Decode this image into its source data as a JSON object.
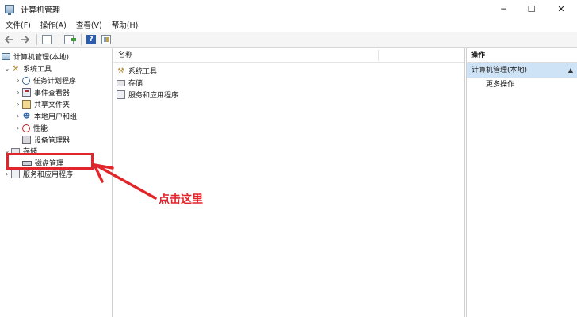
{
  "window": {
    "title": "计算机管理",
    "controls": {
      "minimize": "─",
      "maximize": "☐",
      "close": "✕"
    }
  },
  "menu": {
    "items": [
      "文件(F)",
      "操作(A)",
      "查看(V)",
      "帮助(H)"
    ]
  },
  "toolbar": {
    "back": "back-arrow-icon",
    "forward": "forward-arrow-icon",
    "help_label": "?"
  },
  "tree": {
    "root": "计算机管理(本地)",
    "system_tools": "系统工具",
    "task_scheduler": "任务计划程序",
    "event_viewer": "事件查看器",
    "shared_folders": "共享文件夹",
    "local_users": "本地用户和组",
    "performance": "性能",
    "device_manager": "设备管理器",
    "storage": "存储",
    "disk_management": "磁盘管理",
    "services_apps": "服务和应用程序"
  },
  "center": {
    "column_name": "名称",
    "rows": [
      "系统工具",
      "存储",
      "服务和应用程序"
    ]
  },
  "actions": {
    "title": "操作",
    "group": "计算机管理(本地)",
    "more": "更多操作"
  },
  "annotation": {
    "text": "点击这里",
    "color": "#e0262a"
  },
  "colors": {
    "selection": "#cfe3f6",
    "toolbar_bg": "#f5f5f5"
  }
}
